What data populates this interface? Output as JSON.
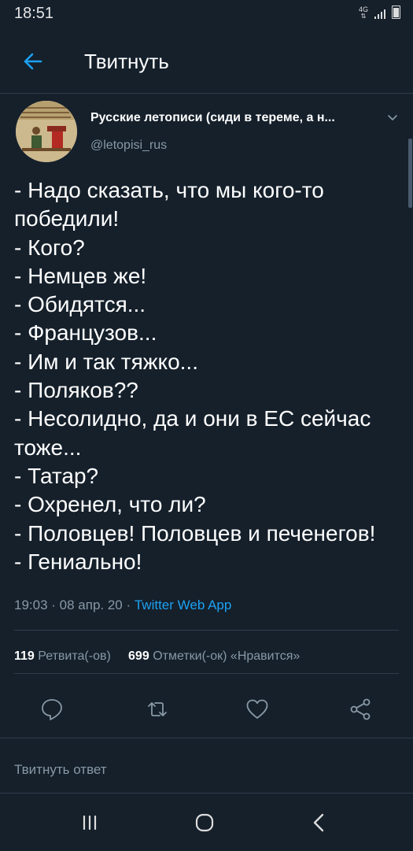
{
  "status_bar": {
    "time": "18:51",
    "network": "4G",
    "icons": [
      "data-arrows-icon",
      "signal-icon",
      "battery-icon"
    ]
  },
  "header": {
    "title": "Твитнуть",
    "back_icon": "arrow-left-icon"
  },
  "tweet": {
    "author_name": "Русские летописи (сиди в тереме, а н...",
    "author_handle": "@letopisi_rus",
    "lines": [
      "- Надо сказать, что мы кого-то",
      "победили!",
      "- Кого?",
      "- Немцев же!",
      "- Обидятся...",
      "- Французов...",
      "- Им и так тяжко...",
      "- Поляков??",
      "- Несолидно, да и они в ЕС сейчас",
      "тоже...",
      "- Татар?",
      "- Охренел, что ли?",
      "- Половцев! Половцев и печенегов!",
      "- Гениально!"
    ],
    "timestamp": "19:03 · 08 апр. 20 · ",
    "source": "Twitter Web App",
    "retweets_count": "119",
    "retweets_label": "Ретвита(-ов)",
    "likes_count": "699",
    "likes_label": "Отметки(-ок) «Нравится»"
  },
  "actions": [
    "reply-icon",
    "retweet-icon",
    "like-icon",
    "share-icon"
  ],
  "reply_input": {
    "placeholder": "Твитнуть ответ"
  },
  "nav_bar": [
    "recents-icon",
    "home-icon",
    "back-icon"
  ],
  "colors": {
    "background": "#15202b",
    "text": "#ffffff",
    "muted": "#8899a6",
    "accent": "#1da1f2",
    "divider": "#2f3c4a"
  }
}
